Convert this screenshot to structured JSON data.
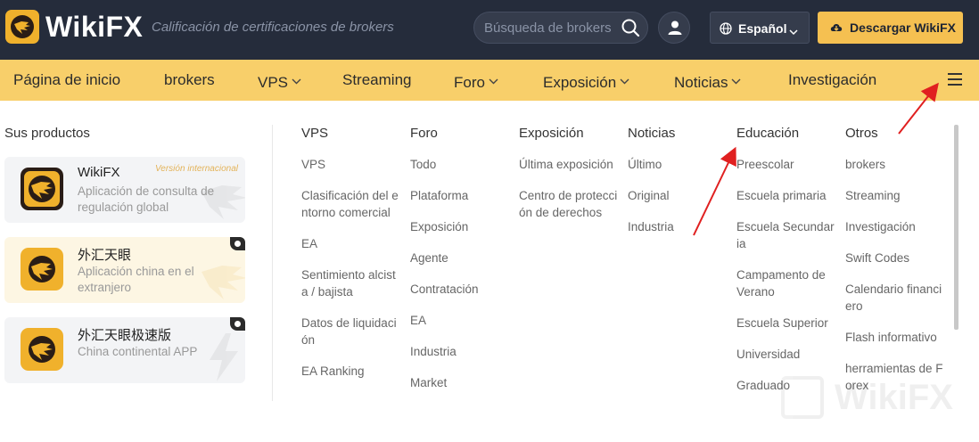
{
  "header": {
    "brand": "WikiFX",
    "tagline": "Calificación de certificaciones de brokers",
    "search_placeholder": "Búsqueda de brokers",
    "language": "Español",
    "download_label": "Descargar WikiFX"
  },
  "nav": {
    "items": [
      {
        "label": "Página de inicio",
        "dropdown": false
      },
      {
        "label": "brokers",
        "dropdown": false
      },
      {
        "label": "VPS",
        "dropdown": true
      },
      {
        "label": "Streaming",
        "dropdown": false
      },
      {
        "label": "Foro",
        "dropdown": true
      },
      {
        "label": "Exposición",
        "dropdown": true
      },
      {
        "label": "Noticias",
        "dropdown": true
      },
      {
        "label": "Investigación",
        "dropdown": false
      }
    ]
  },
  "products": {
    "title": "Sus productos",
    "cards": [
      {
        "name": "WikiFX",
        "badge": "Versión internacional",
        "desc": "Aplicación de consulta de regulación global"
      },
      {
        "name": "外汇天眼",
        "desc": "Aplicación china en el extranjero"
      },
      {
        "name": "外汇天眼极速版",
        "desc": "China continental APP"
      }
    ]
  },
  "columns": [
    {
      "head": "VPS",
      "links": [
        "VPS",
        "Clasificación del entorno comercial",
        "EA",
        "Sentimiento alcista / bajista",
        "Datos de liquidación",
        "EA Ranking"
      ]
    },
    {
      "head": "Foro",
      "links": [
        "Todo",
        "Plataforma",
        "Exposición",
        "Agente",
        "Contratación",
        "EA",
        "Industria",
        "Market"
      ]
    },
    {
      "head": "Exposición",
      "links": [
        "Última exposición",
        "Centro de protección de derechos"
      ]
    },
    {
      "head": "Noticias",
      "links": [
        "Último",
        "Original",
        "Industria"
      ]
    },
    {
      "head": "Educación",
      "links": [
        "Preescolar",
        "Escuela primaria",
        "Escuela Secundaria",
        "Campamento de Verano",
        "Escuela Superior",
        "Universidad",
        "Graduado"
      ]
    },
    {
      "head": "Otros",
      "links": [
        "brokers",
        "Streaming",
        "Investigación",
        "Swift Codes",
        "Calendario financiero",
        "Flash informativo",
        "herramientas de Forex"
      ]
    }
  ],
  "watermark": "WikiFX",
  "colors": {
    "header_bg": "#252c3b",
    "nav_bg": "#f8cf6a",
    "accent": "#f5c051",
    "annotation_arrow": "#e02020"
  }
}
